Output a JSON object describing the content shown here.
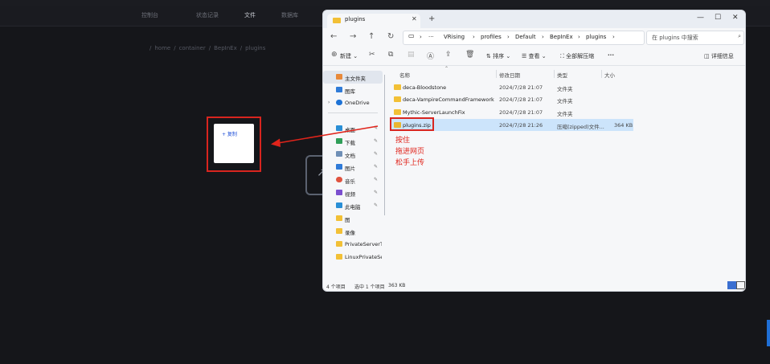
{
  "colors": {
    "accent": "#1f6fd6",
    "annotation": "#e0241b",
    "selection": "#cce4fb",
    "folder": "#f2c036"
  },
  "background_app": {
    "tabs": [
      "控制台",
      "状态记录",
      "文件",
      "数据库"
    ],
    "active_tab": "文件",
    "breadcrumb": [
      "/",
      "home",
      "/",
      "container",
      "/",
      "BepInEx",
      "/",
      "plugins"
    ]
  },
  "drag_ghost": {
    "label": "+ 复制"
  },
  "annotation": {
    "lines": [
      "按住",
      "拖进网页",
      "松手上传"
    ]
  },
  "explorer": {
    "tab_title": "plugins",
    "address": [
      "VRising",
      "profiles",
      "Default",
      "BepInEx",
      "plugins"
    ],
    "search_placeholder": "在 plugins 中搜索",
    "toolbar": {
      "new": "新建",
      "sort": "排序",
      "view": "查看",
      "extract_all": "全部解压缩",
      "more": "···",
      "details": "详细信息"
    },
    "sidebar": [
      {
        "label": "主文件夹",
        "icon": "home-icon",
        "selected": true
      },
      {
        "label": "图库",
        "icon": "gallery-icon"
      },
      {
        "label": "OneDrive",
        "icon": "cloud-icon"
      },
      {
        "label": "桌面",
        "icon": "desktop-icon",
        "pinned": true
      },
      {
        "label": "下载",
        "icon": "download-icon",
        "pinned": true
      },
      {
        "label": "文档",
        "icon": "document-icon",
        "pinned": true
      },
      {
        "label": "图片",
        "icon": "image-icon",
        "pinned": true
      },
      {
        "label": "音乐",
        "icon": "music-icon",
        "pinned": true
      },
      {
        "label": "视频",
        "icon": "video-icon",
        "pinned": true
      },
      {
        "label": "此电脑",
        "icon": "pc-icon",
        "pinned": true
      },
      {
        "label": "图",
        "icon": "folder-icon"
      },
      {
        "label": "录像",
        "icon": "folder-icon"
      },
      {
        "label": "PrivateServerT",
        "icon": "folder-icon"
      },
      {
        "label": "LinuxPrivateSer",
        "icon": "folder-icon"
      }
    ],
    "columns": {
      "name": "名称",
      "date": "修改日期",
      "type": "类型",
      "size": "大小"
    },
    "files": [
      {
        "name": "deca-Bloodstone",
        "date": "2024/7/28 21:07",
        "type": "文件夹",
        "size": ""
      },
      {
        "name": "deca-VampireCommandFramework",
        "date": "2024/7/28 21:07",
        "type": "文件夹",
        "size": ""
      },
      {
        "name": "Mythic-ServerLaunchFix",
        "date": "2024/7/28 21:07",
        "type": "文件夹",
        "size": ""
      },
      {
        "name": "plugins.zip",
        "date": "2024/7/28 21:26",
        "type": "压缩(zipped)文件...",
        "size": "364 KB"
      }
    ],
    "status": {
      "count": "4 个项目",
      "selected": "选中 1 个项目",
      "selected_size": "363 KB"
    }
  }
}
